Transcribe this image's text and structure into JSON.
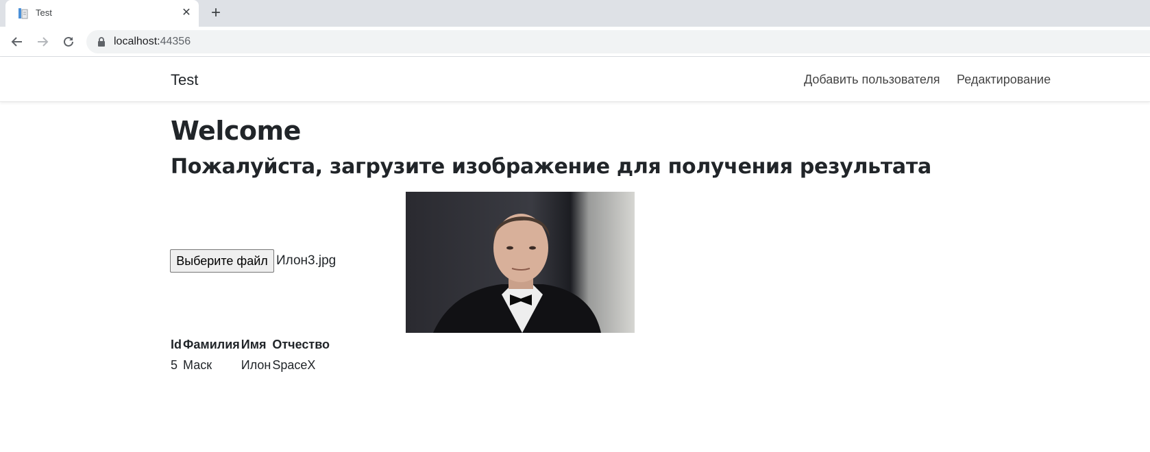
{
  "browser": {
    "tab_title": "Test",
    "new_tab_symbol": "+",
    "close_symbol": "✕",
    "url_host": "localhost:",
    "url_port": "44356"
  },
  "navbar": {
    "brand": "Test",
    "links": [
      "Добавить пользователя",
      "Редактирование"
    ]
  },
  "main": {
    "title": "Welcome",
    "subtitle": "Пожалуйста, загрузите изображение для получения результата",
    "file_button_label": "Выберите файл",
    "file_name": "Илон3.jpg"
  },
  "table": {
    "headers": [
      "Id",
      "Фамилия",
      "Имя",
      "Отчество"
    ],
    "rows": [
      [
        "5",
        "Маск",
        "Илон",
        "SpaceX"
      ]
    ]
  }
}
